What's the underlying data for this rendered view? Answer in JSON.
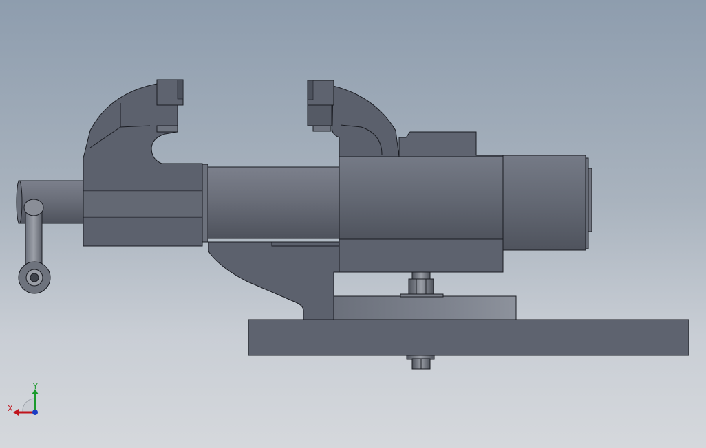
{
  "app": {
    "view": "front"
  },
  "colors": {
    "background_top": "#8e9dae",
    "background_bottom": "#d5d8dc",
    "part_fill": "#5f6470",
    "part_fill_light": "#727784",
    "part_fill_dark": "#4d525d",
    "edge": "#1a1c22",
    "axis_x": "#c0141c",
    "axis_y": "#1b9a2c",
    "axis_z": "#1a3cc4"
  },
  "triad": {
    "x_label": "X",
    "y_label": "Y"
  }
}
